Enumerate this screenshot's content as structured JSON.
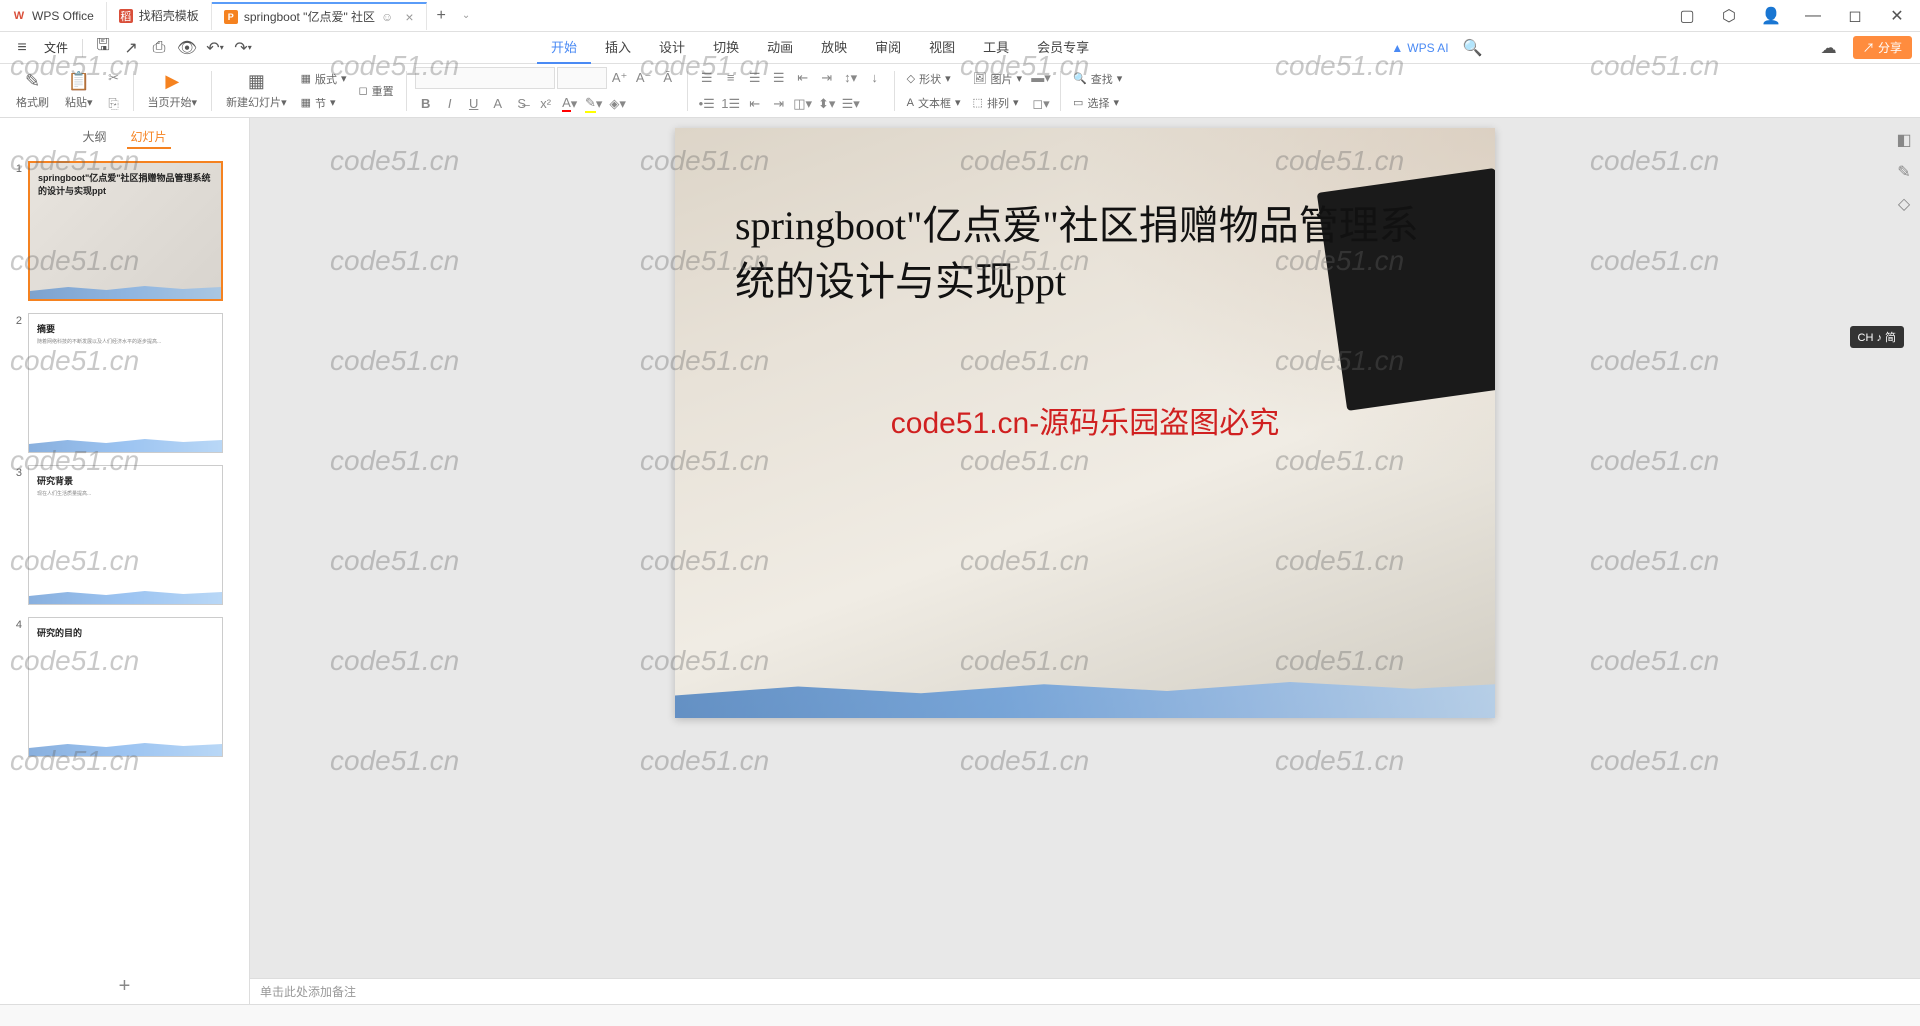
{
  "titlebar": {
    "tabs": [
      {
        "label": "WPS Office",
        "icon": "W"
      },
      {
        "label": "找稻壳模板",
        "icon": "稻"
      },
      {
        "label": "springboot \"亿点爱\" 社区",
        "icon": "P",
        "active": true
      }
    ],
    "add": "+",
    "chevron": "⌄"
  },
  "menubar": {
    "hamburger": "≡",
    "file": "文件",
    "tabs": [
      "开始",
      "插入",
      "设计",
      "切换",
      "动画",
      "放映",
      "审阅",
      "视图",
      "工具",
      "会员专享"
    ],
    "active_tab": "开始",
    "wps_ai": "WPS AI",
    "share": "分享"
  },
  "ribbon": {
    "format_painter": "格式刷",
    "paste": "粘贴",
    "start_page": "当页开始",
    "new_slide": "新建幻灯片",
    "layout": "版式",
    "section": "节",
    "reset": "重置",
    "shape": "形状",
    "image": "图片",
    "textbox": "文本框",
    "arrange": "排列",
    "find": "查找",
    "select": "选择"
  },
  "thumb_panel": {
    "tabs": [
      "大纲",
      "幻灯片"
    ],
    "active": "幻灯片",
    "slides": [
      {
        "num": "1",
        "title": "springboot\"亿点爱\"社区捐赠物品管理系统的设计与实现ppt"
      },
      {
        "num": "2",
        "title": "摘要"
      },
      {
        "num": "3",
        "title": "研究背景"
      },
      {
        "num": "4",
        "title": "研究的目的"
      }
    ]
  },
  "slide": {
    "title": "springboot\"亿点爱\"社区捐赠物品管理系统的设计与实现ppt",
    "red_text": "code51.cn-源码乐园盗图必究"
  },
  "notes": {
    "placeholder": "单击此处添加备注"
  },
  "ime": {
    "label": "CH ♪ 简"
  },
  "watermark": "code51.cn"
}
